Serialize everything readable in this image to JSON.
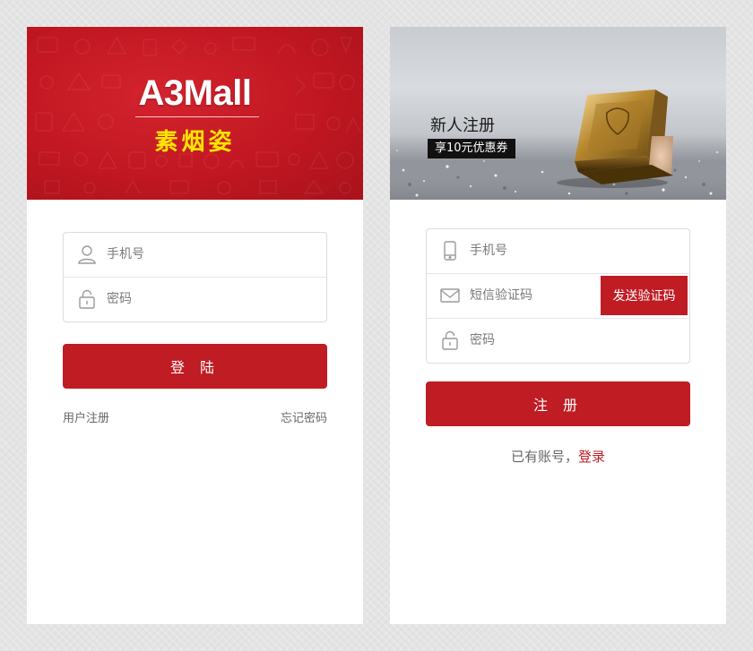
{
  "colors": {
    "brand_red": "#bf1c24",
    "header_red": "#c11722",
    "brand_yellow": "#ffe400",
    "page_bg": "#e4e4e4",
    "text_gray": "#666666"
  },
  "login_screen": {
    "brand_title": "A3Mall",
    "brand_subtitle": "素烟姿",
    "fields": [
      {
        "icon": "user-icon",
        "placeholder": "手机号"
      },
      {
        "icon": "lock-icon",
        "placeholder": "密码"
      }
    ],
    "login_button": "登 陆",
    "register_link": "用户注册",
    "forgot_link": "忘记密码"
  },
  "register_screen": {
    "banner_title": "新人注册",
    "banner_coupon": "享10元优惠券",
    "fields": [
      {
        "icon": "phone-icon",
        "placeholder": "手机号"
      },
      {
        "icon": "mail-icon",
        "placeholder": "短信验证码"
      },
      {
        "icon": "lock-icon",
        "placeholder": "密码"
      }
    ],
    "send_code_button": "发送验证码",
    "register_button": "注 册",
    "have_account_text": "已有账号，",
    "login_link": "登录"
  }
}
